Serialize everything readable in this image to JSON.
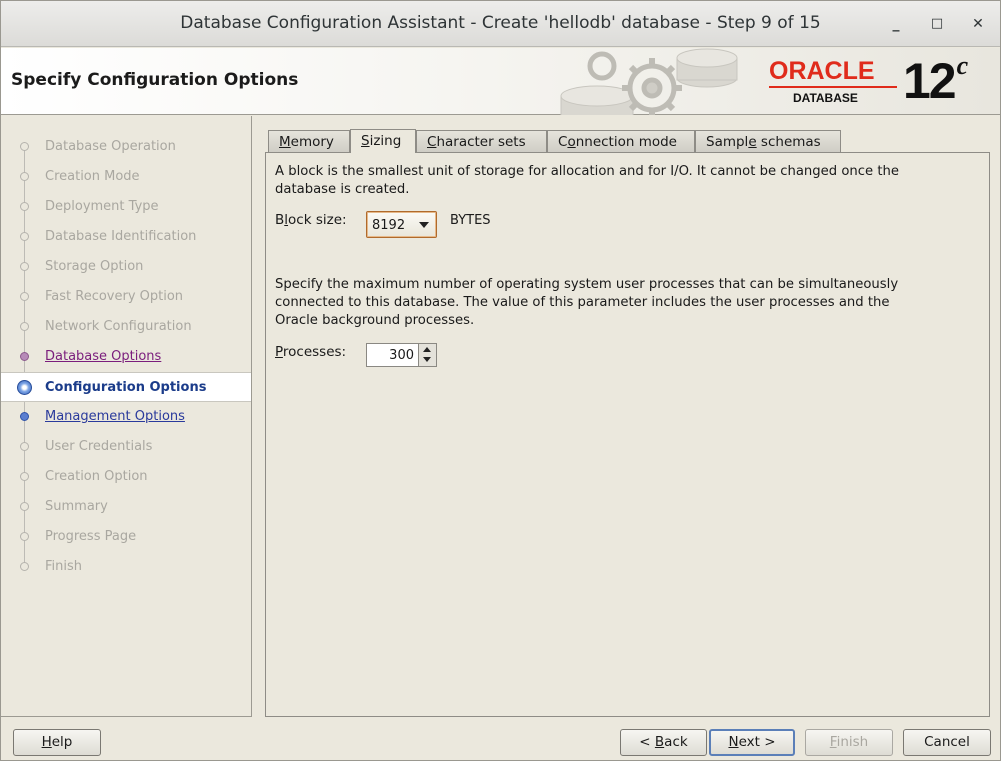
{
  "window": {
    "title": "Database Configuration Assistant - Create 'hellodb' database - Step 9 of 15",
    "controls": {
      "minimize": "_",
      "maximize": "□",
      "close": "✕"
    }
  },
  "header": {
    "page_title": "Specify Configuration Options",
    "logo": {
      "brand": "ORACLE",
      "product": "DATABASE",
      "version": "12",
      "version_suffix": "c"
    }
  },
  "steps": [
    {
      "label": "Database Operation",
      "state": "disabled"
    },
    {
      "label": "Creation Mode",
      "state": "disabled"
    },
    {
      "label": "Deployment Type",
      "state": "disabled"
    },
    {
      "label": "Database Identification",
      "state": "disabled"
    },
    {
      "label": "Storage Option",
      "state": "disabled"
    },
    {
      "label": "Fast Recovery Option",
      "state": "disabled"
    },
    {
      "label": "Network Configuration",
      "state": "disabled"
    },
    {
      "label": "Database Options",
      "state": "visited"
    },
    {
      "label": "Configuration Options",
      "state": "current"
    },
    {
      "label": "Management Options",
      "state": "next"
    },
    {
      "label": "User Credentials",
      "state": "disabled"
    },
    {
      "label": "Creation Option",
      "state": "disabled"
    },
    {
      "label": "Summary",
      "state": "disabled"
    },
    {
      "label": "Progress Page",
      "state": "disabled"
    },
    {
      "label": "Finish",
      "state": "disabled"
    }
  ],
  "tabs": {
    "memory": {
      "pre": "",
      "mn": "M",
      "post": "emory"
    },
    "sizing": {
      "pre": "",
      "mn": "S",
      "post": "izing"
    },
    "charsets": {
      "pre": "",
      "mn": "C",
      "post": "haracter sets"
    },
    "connection": {
      "pre": "C",
      "mn": "o",
      "post": "nnection mode"
    },
    "schemas": {
      "pre": "Sampl",
      "mn": "e",
      "post": " schemas"
    },
    "active": "Sizing"
  },
  "sizing": {
    "block_desc_1": "A block is the smallest unit of storage for allocation and for I/O. It cannot be changed once the",
    "block_desc_2": "database is created.",
    "block_label": {
      "pre": "B",
      "mn": "l",
      "post": "ock size:"
    },
    "block_size_value": "8192",
    "block_size_unit": "BYTES",
    "proc_desc_1": "Specify the maximum number of operating system user processes that can be simultaneously",
    "proc_desc_2": "connected to this database. The value of this parameter includes the user processes and the",
    "proc_desc_3": "Oracle background processes.",
    "processes_label": {
      "pre": "",
      "mn": "P",
      "post": "rocesses:"
    },
    "processes_value": "300"
  },
  "footer": {
    "help": {
      "pre": "",
      "mn": "H",
      "post": "elp"
    },
    "back": {
      "pre": "< ",
      "mn": "B",
      "post": "ack"
    },
    "next": {
      "pre": "",
      "mn": "N",
      "post": "ext >"
    },
    "finish": {
      "pre": "",
      "mn": "F",
      "post": "inish"
    },
    "cancel": "Cancel"
  },
  "colors": {
    "oracle_red": "#e02b1b",
    "current_step": "#1b3c8a",
    "visited_step": "#7a1d7c",
    "next_step": "#2a3a9c"
  }
}
